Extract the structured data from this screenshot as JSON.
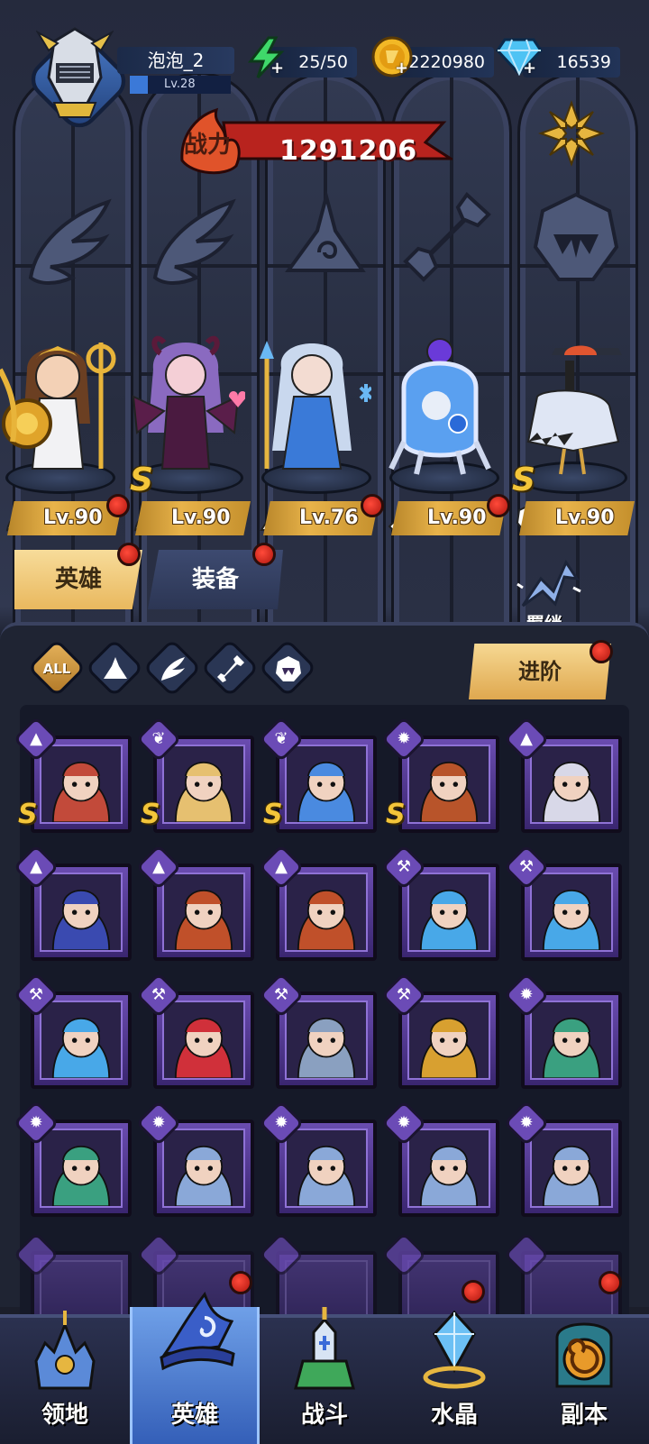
{
  "player": {
    "name": "泡泡_2",
    "level": "Lv.28"
  },
  "resources": {
    "energy": "25/50",
    "gold": "2220980",
    "gems": "16539"
  },
  "power": {
    "label": "战力",
    "value": "1291206"
  },
  "featured_heroes": [
    {
      "level": "Lv.90",
      "class": "wing",
      "s_rank": false,
      "alert": true
    },
    {
      "level": "Lv.90",
      "class": "wing",
      "s_rank": true,
      "alert": false
    },
    {
      "level": "Lv.76",
      "class": "mage",
      "s_rank": false,
      "alert": true
    },
    {
      "level": "Lv.90",
      "class": "wrench",
      "s_rank": false,
      "alert": true
    },
    {
      "level": "Lv.90",
      "class": "beast",
      "s_rank": true,
      "alert": false
    }
  ],
  "tabs": {
    "heroes": "英雄",
    "equipment": "装备"
  },
  "bond_label": "羁绊",
  "filters": {
    "all": "ALL"
  },
  "advance_button": "进阶",
  "roster": [
    {
      "class": "mage",
      "s_rank": true
    },
    {
      "class": "wing",
      "s_rank": true
    },
    {
      "class": "wing",
      "s_rank": true
    },
    {
      "class": "beast",
      "s_rank": true
    },
    {
      "class": "mage",
      "s_rank": false
    },
    {
      "class": "mage",
      "s_rank": false
    },
    {
      "class": "mage",
      "s_rank": false
    },
    {
      "class": "mage",
      "s_rank": false
    },
    {
      "class": "wrench",
      "s_rank": false
    },
    {
      "class": "wrench",
      "s_rank": false
    },
    {
      "class": "wrench",
      "s_rank": false
    },
    {
      "class": "wrench",
      "s_rank": false
    },
    {
      "class": "wrench",
      "s_rank": false
    },
    {
      "class": "wrench",
      "s_rank": false
    },
    {
      "class": "beast",
      "s_rank": false
    },
    {
      "class": "beast",
      "s_rank": false
    },
    {
      "class": "beast",
      "s_rank": false
    },
    {
      "class": "beast",
      "s_rank": false
    },
    {
      "class": "beast",
      "s_rank": false
    },
    {
      "class": "beast",
      "s_rank": false
    }
  ],
  "nav": [
    "领地",
    "英雄",
    "战斗",
    "水晶",
    "副本"
  ],
  "nav_active": "英雄",
  "colors": {
    "accent_gold": "#e9b85e",
    "alert_red": "#e0281c",
    "card_purple": "#5a3ca0",
    "active_nav": "#4f7fd0"
  }
}
